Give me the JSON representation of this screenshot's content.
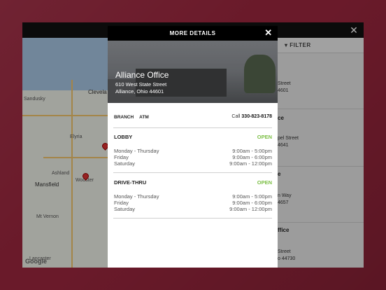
{
  "modal": {
    "header_title": "MORE DETAILS",
    "close_symbol": "✕",
    "location": {
      "name": "Alliance Office",
      "address_line1": "610 West State Street",
      "address_line2": "Alliance, Ohio 44601"
    },
    "tags": [
      "BRANCH",
      "ATM"
    ],
    "call_label": "Call",
    "phone": "330-823-8178",
    "sections": [
      {
        "title": "LOBBY",
        "status": "OPEN",
        "rows": [
          {
            "day": "Monday - Thursday",
            "time": "9:00am - 5:00pm"
          },
          {
            "day": "Friday",
            "time": "9:00am - 6:00pm"
          },
          {
            "day": "Saturday",
            "time": "9:00am - 12:00pm"
          }
        ]
      },
      {
        "title": "DRIVE-THRU",
        "status": "OPEN",
        "rows": [
          {
            "day": "Monday - Thursday",
            "time": "9:00am - 5:00pm"
          },
          {
            "day": "Friday",
            "time": "9:00am - 6:00pm"
          },
          {
            "day": "Saturday",
            "time": "9:00am - 12:00pm"
          }
        ]
      }
    ]
  },
  "background_app": {
    "close_symbol": "✕",
    "filter_label": "FILTER",
    "map_labels": [
      "Clevela",
      "Sandusky",
      "Elyria",
      "Ashland",
      "Mansfield",
      "Wooster",
      "Mt Vernon",
      "Lancaster"
    ],
    "map_brand": "Google",
    "list_fragments": [
      {
        "title": "",
        "a1": "Street",
        "a2": "4601"
      },
      {
        "title": "ce",
        "a1": "pel Street",
        "a2": "4641"
      },
      {
        "title": "e",
        "a1": "n Way",
        "a2": "4657"
      },
      {
        "title": "ffice",
        "a1": "Street",
        "a2": "o 44730"
      }
    ]
  },
  "colors": {
    "background": "#6a1a2a",
    "open_status": "#7bbf44",
    "header": "#000000"
  }
}
